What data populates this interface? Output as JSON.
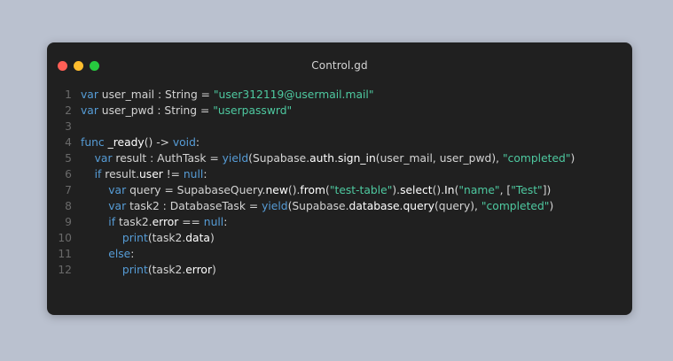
{
  "window": {
    "title": "Control.gd",
    "buttons": [
      "close",
      "minimize",
      "zoom"
    ]
  },
  "colors": {
    "background": "#bac1cf",
    "window": "#202020",
    "keyword": "#569cd6",
    "string": "#4ec9a0",
    "text": "#d4d4d4",
    "line_number": "#6a6a6a"
  },
  "code": {
    "lines": [
      {
        "number": "1",
        "tokens": [
          {
            "t": "var",
            "c": "kw"
          },
          {
            "t": " user_mail : String = ",
            "c": "plain"
          },
          {
            "t": "\"user312119@usermail.mail\"",
            "c": "str"
          }
        ]
      },
      {
        "number": "2",
        "tokens": [
          {
            "t": "var",
            "c": "kw"
          },
          {
            "t": " user_pwd : String = ",
            "c": "plain"
          },
          {
            "t": "\"userpasswrd\"",
            "c": "str"
          }
        ]
      },
      {
        "number": "3",
        "tokens": []
      },
      {
        "number": "4",
        "tokens": [
          {
            "t": "func",
            "c": "kw"
          },
          {
            "t": " _ready",
            "c": "bright"
          },
          {
            "t": "() -> ",
            "c": "plain"
          },
          {
            "t": "void",
            "c": "kw"
          },
          {
            "t": ":",
            "c": "plain"
          }
        ]
      },
      {
        "number": "5",
        "tokens": [
          {
            "t": "    ",
            "c": "plain"
          },
          {
            "t": "var",
            "c": "kw"
          },
          {
            "t": " result : AuthTask = ",
            "c": "plain"
          },
          {
            "t": "yield",
            "c": "kw"
          },
          {
            "t": "(Supabase.",
            "c": "plain"
          },
          {
            "t": "auth",
            "c": "bright"
          },
          {
            "t": ".",
            "c": "plain"
          },
          {
            "t": "sign_in",
            "c": "bright"
          },
          {
            "t": "(user_mail, user_pwd), ",
            "c": "plain"
          },
          {
            "t": "\"completed\"",
            "c": "str"
          },
          {
            "t": ")",
            "c": "plain"
          }
        ]
      },
      {
        "number": "6",
        "tokens": [
          {
            "t": "    ",
            "c": "plain"
          },
          {
            "t": "if",
            "c": "kw"
          },
          {
            "t": " result.",
            "c": "plain"
          },
          {
            "t": "user",
            "c": "bright"
          },
          {
            "t": " != ",
            "c": "plain"
          },
          {
            "t": "null",
            "c": "kw"
          },
          {
            "t": ":",
            "c": "plain"
          }
        ]
      },
      {
        "number": "7",
        "tokens": [
          {
            "t": "        ",
            "c": "plain"
          },
          {
            "t": "var",
            "c": "kw"
          },
          {
            "t": " query = SupabaseQuery.",
            "c": "plain"
          },
          {
            "t": "new",
            "c": "bright"
          },
          {
            "t": "().",
            "c": "plain"
          },
          {
            "t": "from",
            "c": "bright"
          },
          {
            "t": "(",
            "c": "plain"
          },
          {
            "t": "\"test-table\"",
            "c": "str"
          },
          {
            "t": ").",
            "c": "plain"
          },
          {
            "t": "select",
            "c": "bright"
          },
          {
            "t": "().",
            "c": "plain"
          },
          {
            "t": "In",
            "c": "bright"
          },
          {
            "t": "(",
            "c": "plain"
          },
          {
            "t": "\"name\"",
            "c": "str"
          },
          {
            "t": ", [",
            "c": "plain"
          },
          {
            "t": "\"Test\"",
            "c": "str"
          },
          {
            "t": "])",
            "c": "plain"
          }
        ]
      },
      {
        "number": "8",
        "tokens": [
          {
            "t": "        ",
            "c": "plain"
          },
          {
            "t": "var",
            "c": "kw"
          },
          {
            "t": " task2 : DatabaseTask = ",
            "c": "plain"
          },
          {
            "t": "yield",
            "c": "kw"
          },
          {
            "t": "(Supabase.",
            "c": "plain"
          },
          {
            "t": "database",
            "c": "bright"
          },
          {
            "t": ".",
            "c": "plain"
          },
          {
            "t": "query",
            "c": "bright"
          },
          {
            "t": "(query), ",
            "c": "plain"
          },
          {
            "t": "\"completed\"",
            "c": "str"
          },
          {
            "t": ")",
            "c": "plain"
          }
        ]
      },
      {
        "number": "9",
        "tokens": [
          {
            "t": "        ",
            "c": "plain"
          },
          {
            "t": "if",
            "c": "kw"
          },
          {
            "t": " task2.",
            "c": "plain"
          },
          {
            "t": "error",
            "c": "bright"
          },
          {
            "t": " == ",
            "c": "plain"
          },
          {
            "t": "null",
            "c": "kw"
          },
          {
            "t": ":",
            "c": "plain"
          }
        ]
      },
      {
        "number": "10",
        "tokens": [
          {
            "t": "            ",
            "c": "plain"
          },
          {
            "t": "print",
            "c": "kw"
          },
          {
            "t": "(task2.",
            "c": "plain"
          },
          {
            "t": "data",
            "c": "bright"
          },
          {
            "t": ")",
            "c": "plain"
          }
        ]
      },
      {
        "number": "11",
        "tokens": [
          {
            "t": "        ",
            "c": "plain"
          },
          {
            "t": "else",
            "c": "kw"
          },
          {
            "t": ":",
            "c": "plain"
          }
        ]
      },
      {
        "number": "12",
        "tokens": [
          {
            "t": "            ",
            "c": "plain"
          },
          {
            "t": "print",
            "c": "kw"
          },
          {
            "t": "(task2.",
            "c": "plain"
          },
          {
            "t": "error",
            "c": "bright"
          },
          {
            "t": ")",
            "c": "plain"
          }
        ]
      }
    ]
  }
}
